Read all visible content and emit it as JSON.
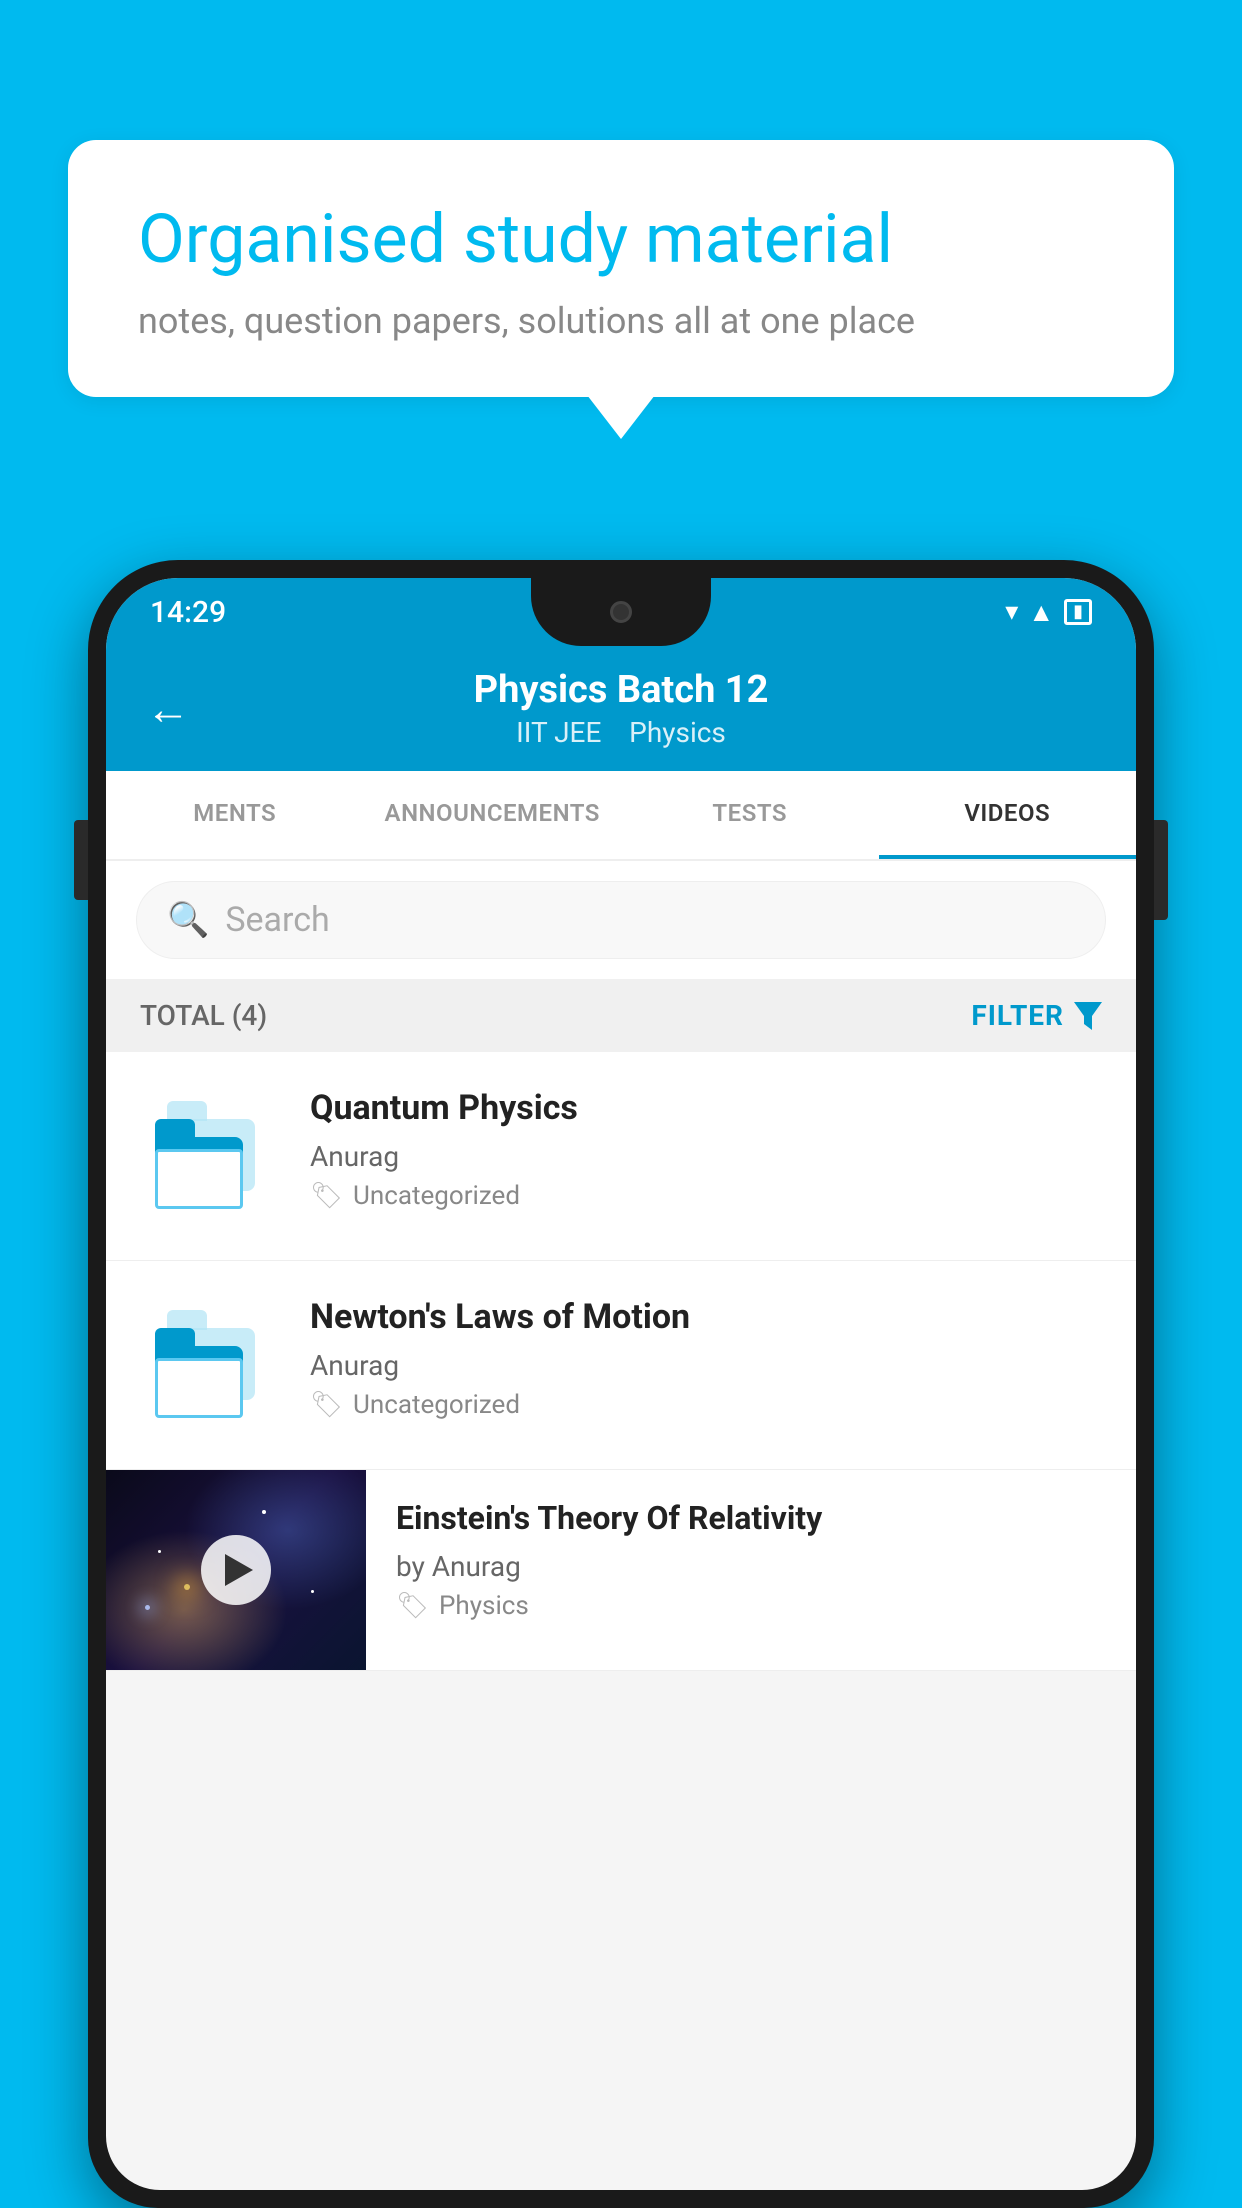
{
  "background_color": "#00BAEF",
  "bubble": {
    "title": "Organised study material",
    "subtitle": "notes, question papers, solutions all at one place"
  },
  "phone": {
    "status_bar": {
      "time": "14:29",
      "icons": [
        "wifi",
        "signal",
        "battery"
      ]
    },
    "header": {
      "title": "Physics Batch 12",
      "subtitle_part1": "IIT JEE",
      "subtitle_part2": "Physics",
      "back_arrow": "←"
    },
    "tabs": [
      {
        "label": "MENTS",
        "active": false
      },
      {
        "label": "ANNOUNCEMENTS",
        "active": false
      },
      {
        "label": "TESTS",
        "active": false
      },
      {
        "label": "VIDEOS",
        "active": true
      }
    ],
    "search": {
      "placeholder": "Search"
    },
    "filter_bar": {
      "total_label": "TOTAL (4)",
      "filter_label": "FILTER"
    },
    "videos": [
      {
        "title": "Quantum Physics",
        "author": "Anurag",
        "tag": "Uncategorized",
        "has_thumbnail": false
      },
      {
        "title": "Newton's Laws of Motion",
        "author": "Anurag",
        "tag": "Uncategorized",
        "has_thumbnail": false
      },
      {
        "title": "Einstein's Theory Of Relativity",
        "author": "by Anurag",
        "tag": "Physics",
        "has_thumbnail": true
      }
    ]
  }
}
